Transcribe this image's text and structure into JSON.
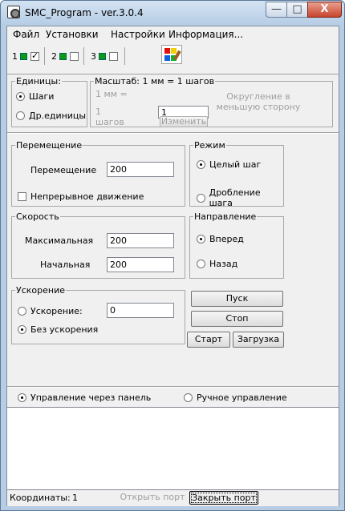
{
  "window": {
    "title": "SMC_Program - ver.3.0.4",
    "min": "—",
    "max": "□",
    "close": "X"
  },
  "menu": [
    "Файл",
    "Установки",
    "Настройки",
    "Информация..."
  ],
  "toolbar": {
    "groups": [
      {
        "num": "1",
        "checked": true
      },
      {
        "num": "2",
        "checked": false
      },
      {
        "num": "3",
        "checked": false
      }
    ]
  },
  "units": {
    "legend": "Единицы:",
    "steps": "Шаги",
    "other": "Др.единицы",
    "selected": "Шаги"
  },
  "scale": {
    "label": "Масштаб: 1 мм = 1 шагов",
    "mm": "1 мм =",
    "one": "1",
    "steps_label": "шагов",
    "value": "1",
    "rounding": "Округление в меньшую сторону",
    "change_btn": "Изменить"
  },
  "move": {
    "legend": "Перемещение",
    "label": "Перемещение",
    "value": "200",
    "continuous": "Непрерывное движение",
    "continuous_checked": false
  },
  "mode": {
    "legend": "Режим",
    "full": "Целый шаг",
    "micro": "Дробление шага",
    "selected": "Целый шаг"
  },
  "speed": {
    "legend": "Скорость",
    "max_label": "Максимальная",
    "max_value": "200",
    "start_label": "Начальная",
    "start_value": "200"
  },
  "direction": {
    "legend": "Направление",
    "fwd": "Вперед",
    "back": "Назад",
    "selected": "Вперед"
  },
  "accel": {
    "legend": "Ускорение",
    "accel_label": "Ускорение:",
    "accel_value": "0",
    "none": "Без ускорения",
    "selected": "Без ускорения"
  },
  "buttons": {
    "run": "Пуск",
    "stop": "Стоп",
    "start": "Старт",
    "load": "Загрузка"
  },
  "control": {
    "panel": "Управление через панель",
    "manual": "Ручное управление",
    "selected": "Управление через панель"
  },
  "status": {
    "coords_label": "Координаты:",
    "coords_value": "1",
    "open_port": "Открыть порт",
    "close_port": "Закрыть порт"
  },
  "colors": {
    "accent_green": "#0a9a18",
    "titlebar": "#b8cde3",
    "close": "#c7462e"
  }
}
